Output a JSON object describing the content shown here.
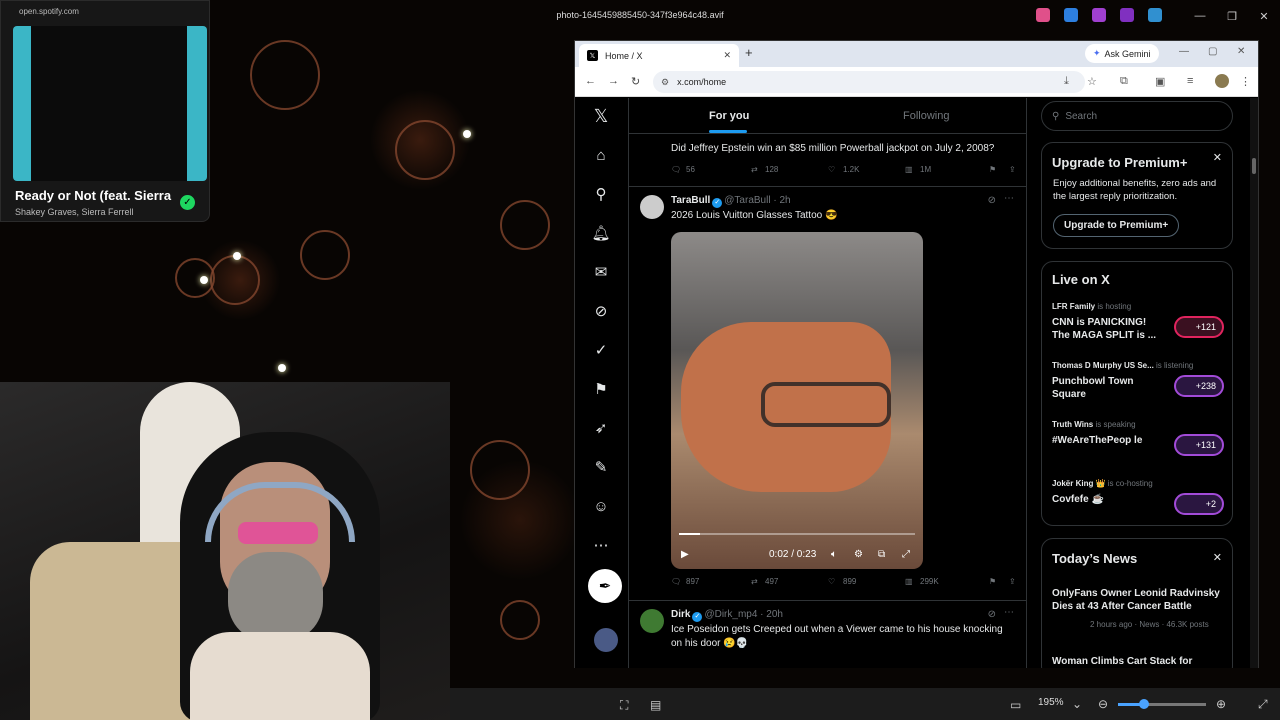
{
  "viewer": {
    "title": "photo-1645459885450-347f3e964c48.avif",
    "zoom": "195%",
    "zoom_fraction": 0.3
  },
  "spotify": {
    "url": "open.spotify.com",
    "title": "Ready or Not (feat. Sierra",
    "artist": "Shakey Graves, Sierra Ferrell"
  },
  "browser": {
    "tab_title": "Home / X",
    "gemini": "Ask Gemini",
    "url": "x.com/home"
  },
  "x": {
    "tabs": [
      "For you",
      "Following"
    ],
    "top_post": {
      "text": "Did Jeffrey Epstein win an $85 million Powerball jackpot on July 2, 2008?",
      "replies": "56",
      "reposts": "128",
      "likes": "1.2K",
      "views": "1M"
    },
    "post1": {
      "name": "TaraBull",
      "handle": "@TaraBull · 2h",
      "text": "2026 Louis Vuitton Glasses Tattoo 😎",
      "time": "0:02 / 0:23",
      "progress": 0.09,
      "replies": "897",
      "reposts": "497",
      "likes": "899",
      "views": "299K"
    },
    "post2": {
      "name": "Dirk",
      "handle": "@Dirk_mp4 · 20h",
      "text": "Ice Poseidon gets Creeped out when a Viewer came to his house knocking on his door 😢💀"
    },
    "search_placeholder": "Search",
    "premium": {
      "title": "Upgrade to Premium+",
      "body": "Enjoy additional benefits, zero ads and the largest reply prioritization.",
      "button": "Upgrade to Premium+"
    },
    "live": {
      "title": "Live on X",
      "items": [
        {
          "host": "LFR Family",
          "status": "is hosting",
          "title": "CNN is PANICKING! The MAGA SPLIT is ...",
          "count": "+121"
        },
        {
          "host": "Thomas D Murphy US Se...",
          "status": "is listening",
          "title": "Punchbowl Town Square",
          "count": "+238"
        },
        {
          "host": "Truth Wins",
          "status": "is speaking",
          "title": "#WeAreThePeop le",
          "count": "+131"
        },
        {
          "host": "Jokër King 👑",
          "status": "is co-hosting",
          "title": "Covfefe ☕",
          "count": "+2"
        }
      ]
    },
    "news": {
      "title": "Today’s News",
      "items": [
        {
          "title": "OnlyFans Owner Leonid Radvinsky Dies at 43 After Cancer Battle",
          "meta": "2 hours ago · News · 46.3K posts"
        },
        {
          "title": "Woman Climbs Cart Stack for",
          "meta": ""
        }
      ]
    }
  }
}
